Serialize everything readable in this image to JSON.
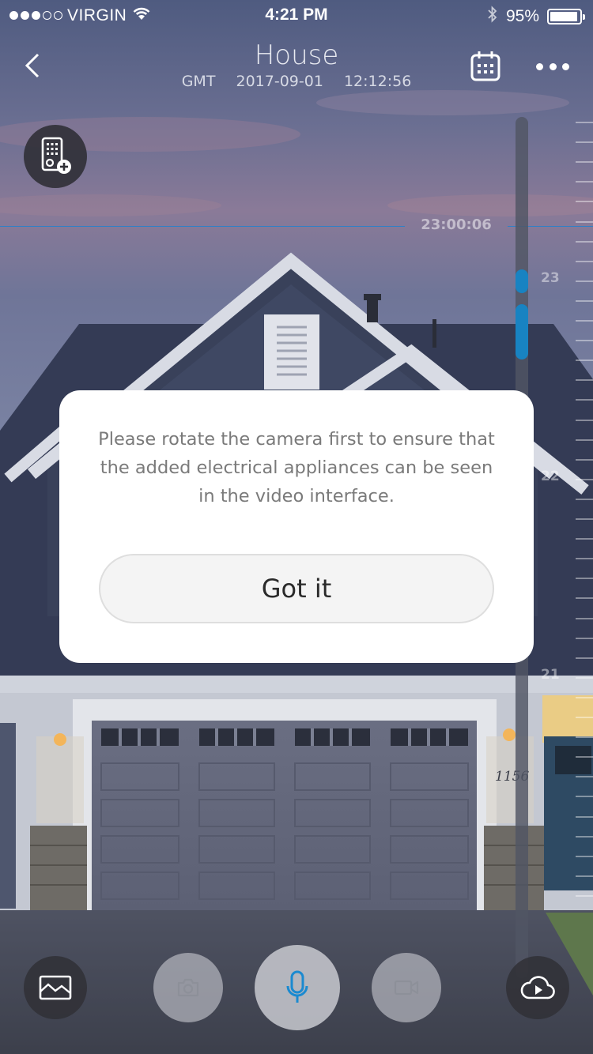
{
  "status_bar": {
    "carrier": "VIRGIN",
    "time": "4:21 PM",
    "battery": "95%",
    "battery_level": 0.95,
    "signal_bars": 3,
    "signal_total": 5
  },
  "nav": {
    "title": "House",
    "timezone": "GMT",
    "date": "2017-09-01",
    "clock": "12:12:56"
  },
  "timeline": {
    "current_time": "23:00:06",
    "hour_labels": [
      "23",
      "22",
      "21"
    ],
    "accent": "#1883c2"
  },
  "scene": {
    "house_number": "1156"
  },
  "modal": {
    "message": "Please rotate the camera first to ensure that the added electrical appliances can be seen in the video interface.",
    "button_label": "Got it"
  },
  "bottom_bar": {
    "icons": [
      "landscape-icon",
      "camera-icon",
      "microphone-icon",
      "video-camera-icon",
      "cloud-play-icon"
    ]
  }
}
